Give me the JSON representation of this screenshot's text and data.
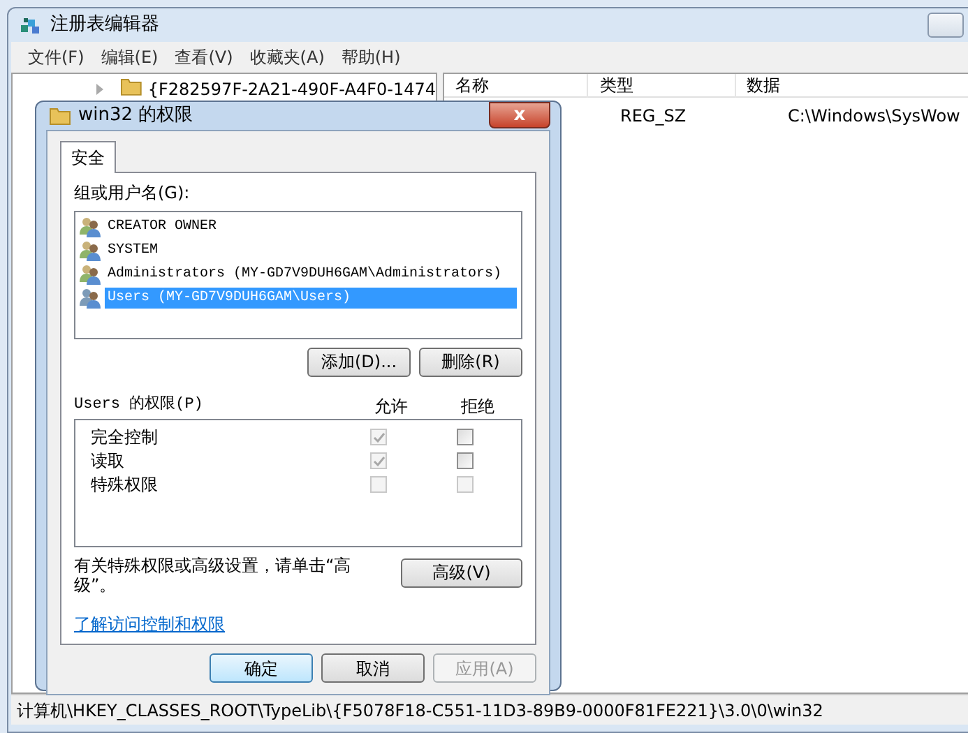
{
  "window": {
    "title": "注册表编辑器"
  },
  "menu": [
    "文件(F)",
    "编辑(E)",
    "查看(V)",
    "收藏夹(A)",
    "帮助(H)"
  ],
  "tree": {
    "items": [
      {
        "label": "{F282597F-2A21-490F-A4F0-1474",
        "expanded": false
      }
    ]
  },
  "values_table": {
    "columns": [
      "名称",
      "类型",
      "数据"
    ],
    "rows": [
      {
        "type": "REG_SZ",
        "data": "C:\\Windows\\SysWow"
      }
    ]
  },
  "status_bar": "计算机\\HKEY_CLASSES_ROOT\\TypeLib\\{F5078F18-C551-11D3-89B9-0000F81FE221}\\3.0\\0\\win32",
  "dialog": {
    "title": "win32 的权限",
    "close": "x",
    "tabs": [
      {
        "label": "安全",
        "selected": true
      }
    ],
    "groups_label": "组或用户名(G):",
    "groups": [
      {
        "name": "CREATOR OWNER",
        "selected": false
      },
      {
        "name": "SYSTEM",
        "selected": false
      },
      {
        "name": "Administrators (MY-GD7V9DUH6GAM\\Administrators)",
        "selected": false
      },
      {
        "name": "Users (MY-GD7V9DUH6GAM\\Users)",
        "selected": true
      }
    ],
    "group_buttons": [
      "添加(D)...",
      "删除(R)"
    ],
    "permissions_label": "Users 的权限(P)",
    "allow_label": "允许",
    "deny_label": "拒绝",
    "permissions": [
      {
        "name": "完全控制",
        "allow": {
          "checked": true,
          "disabled": true
        },
        "deny": {
          "checked": false,
          "disabled": false
        }
      },
      {
        "name": "读取",
        "allow": {
          "checked": true,
          "disabled": true
        },
        "deny": {
          "checked": false,
          "disabled": false
        }
      },
      {
        "name": "特殊权限",
        "allow": {
          "checked": false,
          "disabled": true
        },
        "deny": {
          "checked": false,
          "disabled": true
        }
      }
    ],
    "advanced_note": "有关特殊权限或高级设置，请单击“高级”。",
    "advanced_button": "高级(V)",
    "link": "了解访问控制和权限",
    "buttons": [
      {
        "label": "确定",
        "kind": "default",
        "disabled": false
      },
      {
        "label": "取消",
        "kind": "normal",
        "disabled": false
      },
      {
        "label": "应用(A)",
        "kind": "normal",
        "disabled": true
      }
    ]
  }
}
